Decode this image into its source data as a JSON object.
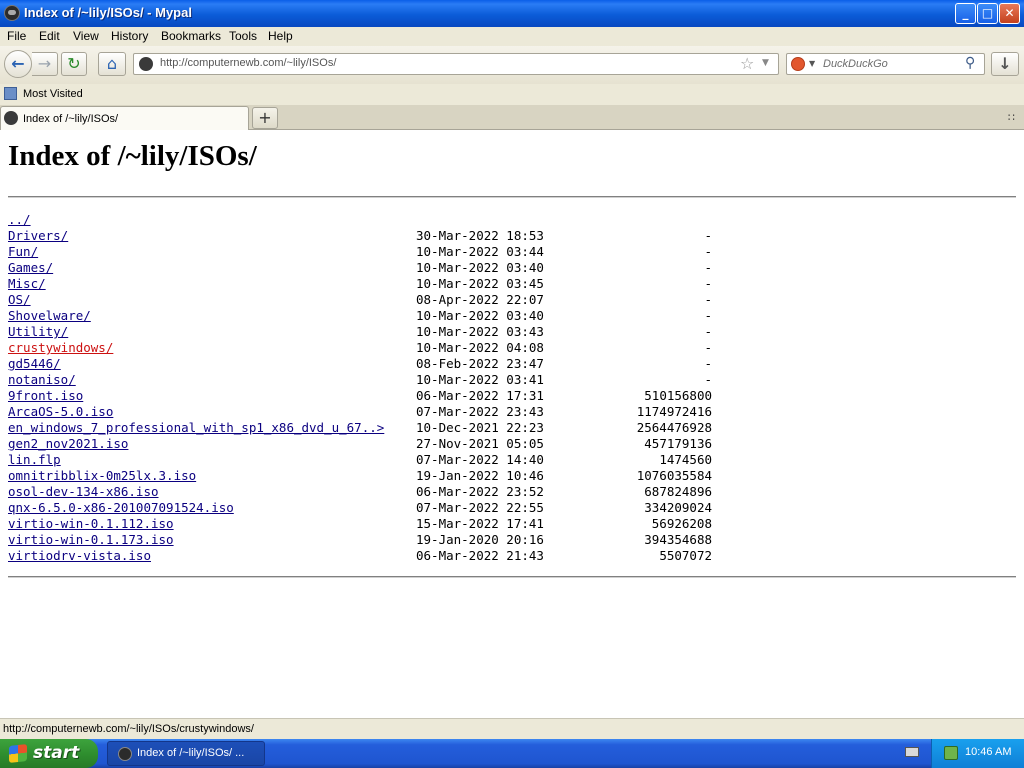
{
  "window": {
    "title": "Index of /~lily/ISOs/ - Mypal",
    "minimize": "_",
    "maximize": "□",
    "close": "✕"
  },
  "menu": [
    "File",
    "Edit",
    "View",
    "History",
    "Bookmarks",
    "Tools",
    "Help"
  ],
  "nav": {
    "back_icon": "←",
    "forward_icon": "→",
    "reload_icon": "↻",
    "home_icon": "⌂",
    "url": "http://computernewb.com/~lily/ISOs/",
    "star_icon": "☆",
    "url_dropdown_icon": "▼",
    "search_placeholder": "DuckDuckGo",
    "search_icon": "⚲",
    "engine_dropdown_icon": "▼",
    "download_icon": "↓"
  },
  "bookmarks": {
    "most_visited": "Most Visited"
  },
  "tabs": {
    "active_label": "Index of /~lily/ISOs/",
    "new_tab": "+",
    "tab_list_icon": "∷"
  },
  "page": {
    "heading": "Index of /~lily/ISOs/",
    "entries": [
      {
        "name": "../",
        "date": "",
        "size": "",
        "visited": false
      },
      {
        "name": "Drivers/",
        "date": "30-Mar-2022 18:53",
        "size": "-",
        "visited": false
      },
      {
        "name": "Fun/",
        "date": "10-Mar-2022 03:44",
        "size": "-",
        "visited": false
      },
      {
        "name": "Games/",
        "date": "10-Mar-2022 03:40",
        "size": "-",
        "visited": false
      },
      {
        "name": "Misc/",
        "date": "10-Mar-2022 03:45",
        "size": "-",
        "visited": false
      },
      {
        "name": "OS/",
        "date": "08-Apr-2022 22:07",
        "size": "-",
        "visited": false
      },
      {
        "name": "Shovelware/",
        "date": "10-Mar-2022 03:40",
        "size": "-",
        "visited": false
      },
      {
        "name": "Utility/",
        "date": "10-Mar-2022 03:43",
        "size": "-",
        "visited": false
      },
      {
        "name": "crustywindows/",
        "date": "10-Mar-2022 04:08",
        "size": "-",
        "visited": true
      },
      {
        "name": "gd5446/",
        "date": "08-Feb-2022 23:47",
        "size": "-",
        "visited": false
      },
      {
        "name": "notaniso/",
        "date": "10-Mar-2022 03:41",
        "size": "-",
        "visited": false
      },
      {
        "name": "9front.iso",
        "date": "06-Mar-2022 17:31",
        "size": "510156800",
        "visited": false
      },
      {
        "name": "ArcaOS-5.0.iso",
        "date": "07-Mar-2022 23:43",
        "size": "1174972416",
        "visited": false
      },
      {
        "name": "en_windows_7_professional_with_sp1_x86_dvd_u_67..>",
        "date": "10-Dec-2021 22:23",
        "size": "2564476928",
        "visited": false
      },
      {
        "name": "gen2_nov2021.iso",
        "date": "27-Nov-2021 05:05",
        "size": "457179136",
        "visited": false
      },
      {
        "name": "lin.flp",
        "date": "07-Mar-2022 14:40",
        "size": "1474560",
        "visited": false
      },
      {
        "name": "omnitribblix-0m25lx.3.iso",
        "date": "19-Jan-2022 10:46",
        "size": "1076035584",
        "visited": false
      },
      {
        "name": "osol-dev-134-x86.iso",
        "date": "06-Mar-2022 23:52",
        "size": "687824896",
        "visited": false
      },
      {
        "name": "qnx-6.5.0-x86-201007091524.iso",
        "date": "07-Mar-2022 22:55",
        "size": "334209024",
        "visited": false
      },
      {
        "name": "virtio-win-0.1.112.iso",
        "date": "15-Mar-2022 17:41",
        "size": "56926208",
        "visited": false
      },
      {
        "name": "virtio-win-0.1.173.iso",
        "date": "19-Jan-2020 20:16",
        "size": "394354688",
        "visited": false
      },
      {
        "name": "virtiodrv-vista.iso",
        "date": "06-Mar-2022 21:43",
        "size": "5507072",
        "visited": false
      }
    ]
  },
  "status": {
    "text": "http://computernewb.com/~lily/ISOs/crustywindows/"
  },
  "taskbar": {
    "start": "start",
    "task_label": "Index of /~lily/ISOs/ ...",
    "clock": "10:46 AM"
  },
  "colors": {
    "link": "#0b0080",
    "visited_link": "#cc1111",
    "titlebar": "#0a5ee8",
    "taskbar": "#245edb"
  }
}
